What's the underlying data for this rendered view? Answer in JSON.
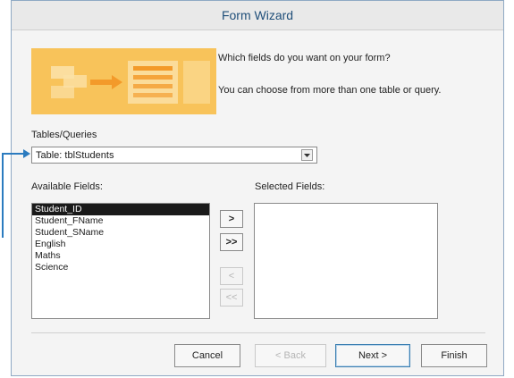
{
  "window": {
    "title": "Form Wizard"
  },
  "prompts": {
    "question": "Which fields do you want on your form?",
    "hint": "You can choose from more than one table or query."
  },
  "tables_queries": {
    "label": "Tables/Queries",
    "selected": "Table: tblStudents"
  },
  "available_fields": {
    "label": "Available Fields:",
    "items": [
      "Student_ID",
      "Student_FName",
      "Student_SName",
      "English",
      "Maths",
      "Science"
    ],
    "selected_index": 0
  },
  "selected_fields": {
    "label": "Selected Fields:",
    "items": []
  },
  "move_buttons": {
    "add_one": ">",
    "add_all": ">>",
    "remove_one": "<",
    "remove_all": "<<"
  },
  "buttons": {
    "cancel": "Cancel",
    "back": "< Back",
    "next": "Next >",
    "finish": "Finish"
  },
  "colors": {
    "banner": "#f8c35a",
    "title_text": "#1f4e79",
    "callout": "#2b7bbf"
  }
}
